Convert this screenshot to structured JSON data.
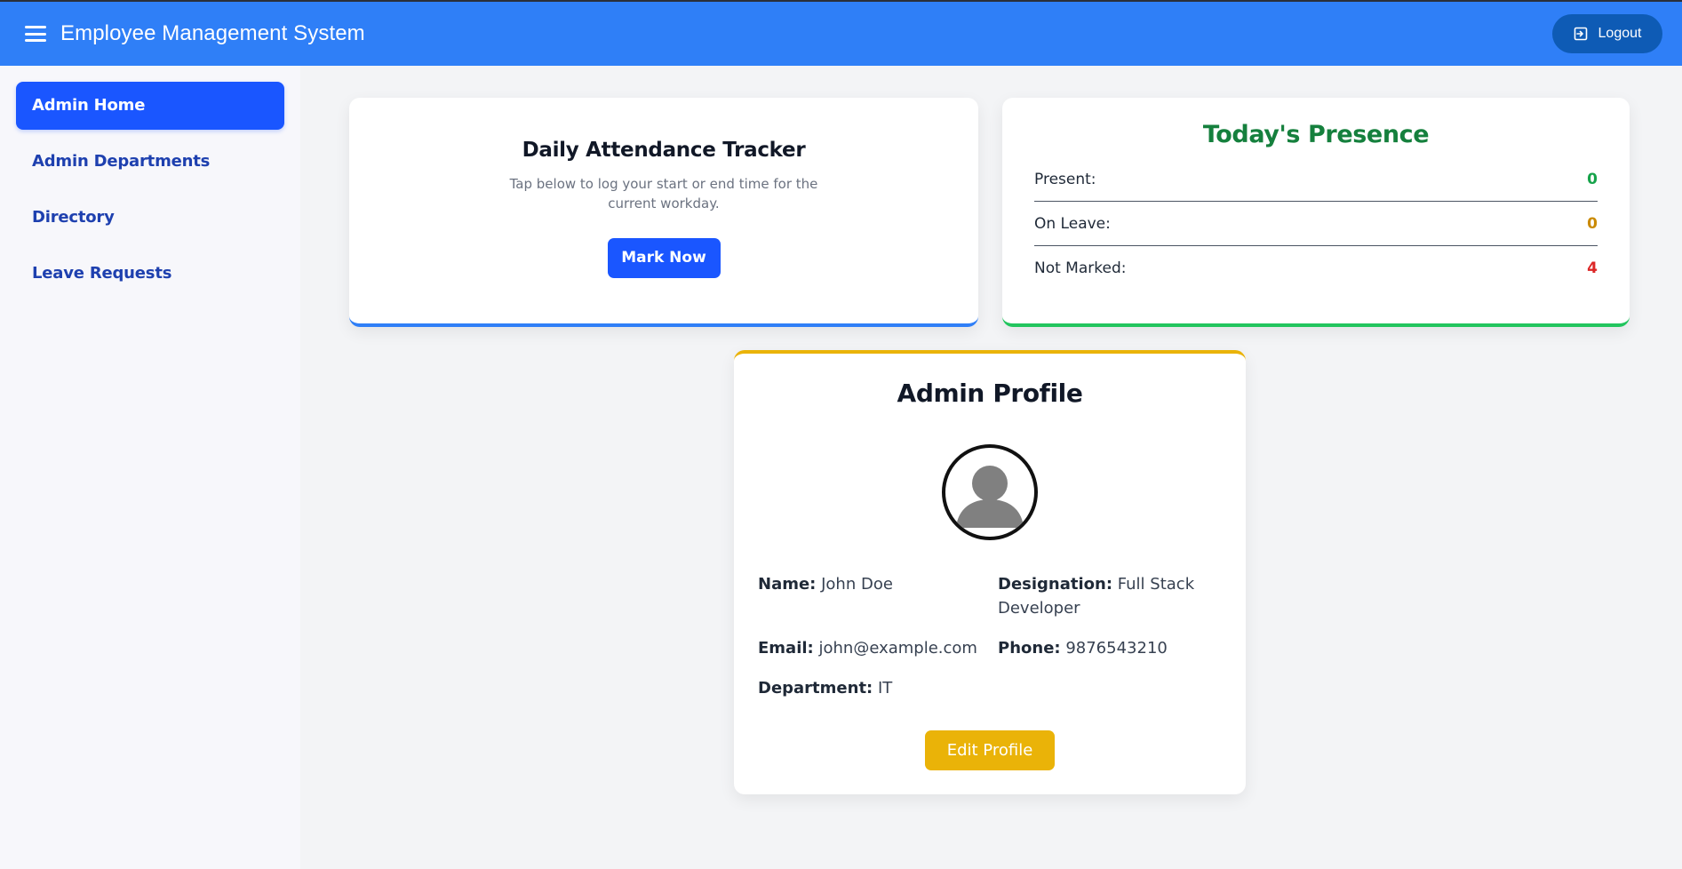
{
  "header": {
    "title": "Employee Management System",
    "logout_label": "Logout",
    "brand_color": "#2f7ff7"
  },
  "sidebar": {
    "items": [
      {
        "label": "Admin Home",
        "active": true
      },
      {
        "label": "Admin Departments",
        "active": false
      },
      {
        "label": "Directory",
        "active": false
      },
      {
        "label": "Leave Requests",
        "active": false
      }
    ]
  },
  "tracker": {
    "title": "Daily Attendance Tracker",
    "description": "Tap below to log your start or end time for the current workday.",
    "button_label": "Mark Now"
  },
  "presence": {
    "title": "Today's Presence",
    "rows": [
      {
        "label": "Present:",
        "value": "0",
        "color": "#16a34a"
      },
      {
        "label": "On Leave:",
        "value": "0",
        "color": "#ca8a04"
      },
      {
        "label": "Not Marked:",
        "value": "4",
        "color": "#dc2626"
      }
    ]
  },
  "profile": {
    "title": "Admin Profile",
    "fields": {
      "name": {
        "label": "Name:",
        "value": "John Doe"
      },
      "designation": {
        "label": "Designation:",
        "value": "Full Stack Developer"
      },
      "email": {
        "label": "Email:",
        "value": "john@example.com"
      },
      "phone": {
        "label": "Phone:",
        "value": "9876543210"
      },
      "department": {
        "label": "Department:",
        "value": "IT"
      }
    },
    "edit_label": "Edit Profile"
  },
  "icons": {
    "menu": "hamburger-icon",
    "logout": "logout-icon",
    "avatar": "user-avatar-icon"
  }
}
